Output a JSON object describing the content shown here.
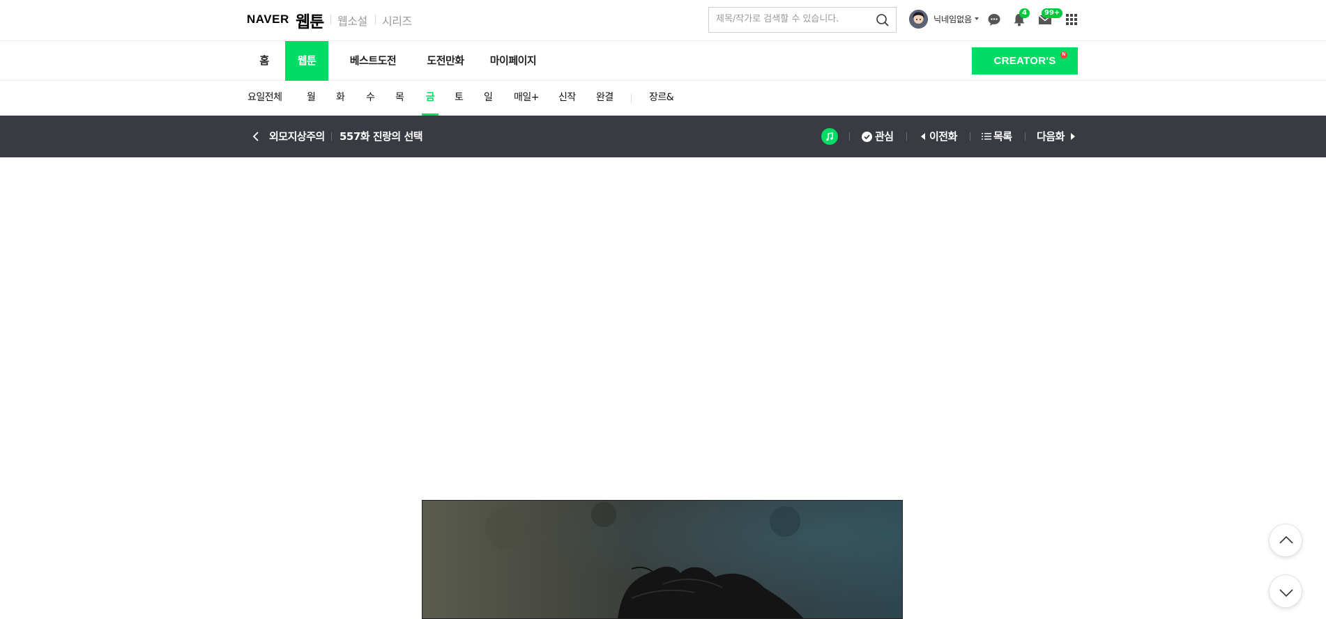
{
  "header": {
    "logo_naver": "NAVER",
    "logo_webtoon": "웹툰",
    "services": [
      "웹소설",
      "시리즈"
    ],
    "search_placeholder": "제목/작가로 검색할 수 있습니다.",
    "nickname": "닉네임없음",
    "notification_count": "4",
    "mail_count": "99+"
  },
  "gnb": {
    "items": [
      "홈",
      "웹툰",
      "베스트도전",
      "도전만화",
      "마이페이지"
    ],
    "active": "웹툰",
    "creators_label": "CREATOR'S",
    "creators_badge": "N"
  },
  "days": {
    "items": [
      "요일전체",
      "월",
      "화",
      "수",
      "목",
      "금",
      "토",
      "일",
      "매일+",
      "신작",
      "완결"
    ],
    "genre": "장르&",
    "active": "금"
  },
  "viewer": {
    "title": "외모지상주의",
    "episode": "557화 진랑의 선택",
    "favorite_label": "관심",
    "prev_label": "이전화",
    "list_label": "목록",
    "next_label": "다음화"
  },
  "colors": {
    "accent": "#00dc64",
    "viewer_bar": "#393b42",
    "badge": "#00c73c"
  }
}
